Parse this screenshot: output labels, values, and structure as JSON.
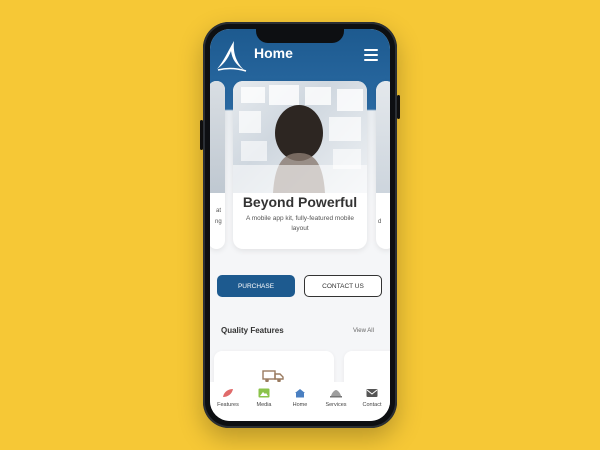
{
  "header": {
    "title": "Home"
  },
  "slider": {
    "main": {
      "title": "Beyond Powerful",
      "subtitle": "A mobile app kit, fully-featured mobile layout"
    },
    "left_peek_text": [
      "at",
      "ng"
    ],
    "right_peek_text": [
      "d"
    ]
  },
  "actions": {
    "purchase_label": "PURCHASE",
    "contact_label": "CONTACT US"
  },
  "features": {
    "title": "Quality Features",
    "view_all": "View All"
  },
  "tabbar": {
    "items": [
      {
        "label": "Features",
        "icon": "leaf-icon"
      },
      {
        "label": "Media",
        "icon": "media-icon"
      },
      {
        "label": "Home",
        "icon": "home-icon"
      },
      {
        "label": "Services",
        "icon": "services-icon"
      },
      {
        "label": "Contact",
        "icon": "mail-icon"
      }
    ]
  },
  "colors": {
    "background": "#F6C836",
    "primary": "#1d5a8f",
    "header": "#2a6aa3"
  }
}
